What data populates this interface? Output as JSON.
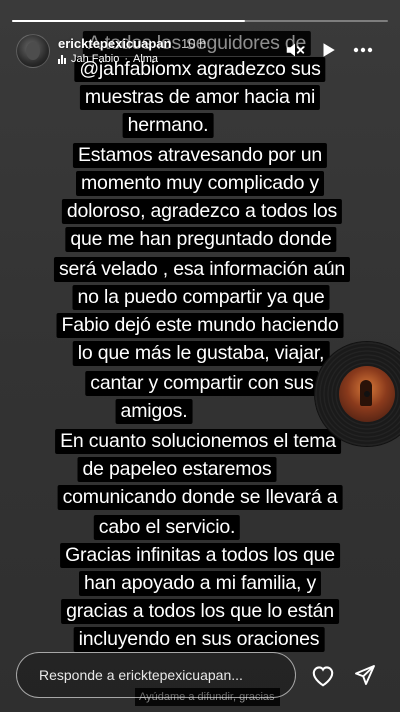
{
  "story": {
    "progress_fraction": 0.62
  },
  "header": {
    "username": "ericktepexicuapan",
    "time_ago": "10 h",
    "music_artist": "Jah Fabio",
    "music_separator": "·",
    "music_title": "Alma",
    "icons": [
      "mute-icon",
      "play-icon",
      "more-icon"
    ]
  },
  "message_lines": [
    "A todos los seguidores de",
    "@jahfabiomx agradezco sus",
    "muestras de amor hacia mi",
    "hermano.",
    "Estamos atravesando por un",
    "momento muy complicado y",
    "doloroso, agradezco a todos los",
    "que me han preguntado donde",
    "será velado , esa información aún",
    "no la puedo compartir ya que",
    "Fabio dejó este mundo haciendo",
    "lo que más le gustaba, viajar,",
    "cantar y compartir con sus",
    "amigos.",
    "En cuanto solucionemos el tema",
    "de papeleo estaremos",
    "comunicando donde se llevará a",
    "cabo el servicio.",
    "Gracias infinitas a todos los que",
    "han apoyado a mi familia, y",
    "gracias a todos los que lo están",
    "incluyendo en sus oraciones"
  ],
  "bottom_note": "Ayúdame a difundir, gracias",
  "reply": {
    "placeholder": "Responde a ericktepexicuapan..."
  },
  "footer_icons": [
    "heart-icon",
    "send-icon"
  ]
}
